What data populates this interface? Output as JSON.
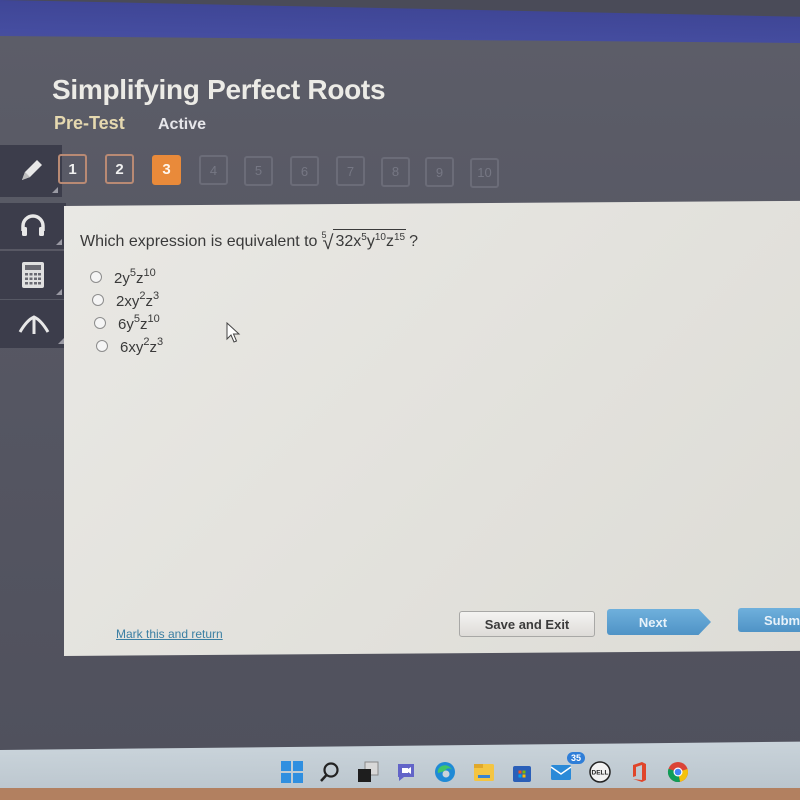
{
  "header": {
    "title": "Simplifying Perfect Roots",
    "subtitle": "Pre-Test",
    "status": "Active"
  },
  "tools": [
    {
      "name": "pencil",
      "icon": "pencil-icon"
    },
    {
      "name": "text-to-speech-headphones",
      "icon": "headphones-icon"
    },
    {
      "name": "calculator",
      "icon": "calculator-icon"
    },
    {
      "name": "collapse-tools",
      "icon": "caret-up-icon"
    }
  ],
  "question_nav": {
    "items": [
      {
        "label": "1",
        "state": "answered"
      },
      {
        "label": "2",
        "state": "answered"
      },
      {
        "label": "3",
        "state": "current"
      },
      {
        "label": "4",
        "state": "locked"
      },
      {
        "label": "5",
        "state": "locked"
      },
      {
        "label": "6",
        "state": "locked"
      },
      {
        "label": "7",
        "state": "locked"
      },
      {
        "label": "8",
        "state": "locked"
      },
      {
        "label": "9",
        "state": "locked"
      },
      {
        "label": "10",
        "state": "locked"
      }
    ],
    "active_color": "#E98A3A"
  },
  "question": {
    "prompt": "Which expression is equivalent to",
    "radical_index": "5",
    "radicand": {
      "coef": "32",
      "terms": [
        {
          "var": "x",
          "exp": "5"
        },
        {
          "var": "y",
          "exp": "10"
        },
        {
          "var": "z",
          "exp": "15"
        }
      ]
    },
    "end_mark": "?"
  },
  "choices": [
    {
      "coef": "2",
      "terms": [
        {
          "var": "y",
          "exp": "5"
        },
        {
          "var": "z",
          "exp": "10"
        }
      ],
      "text": "2y^5z^10",
      "selected": false
    },
    {
      "coef": "2",
      "terms": [
        {
          "var": "x",
          "exp": ""
        },
        {
          "var": "y",
          "exp": "2"
        },
        {
          "var": "z",
          "exp": "3"
        }
      ],
      "text": "2xy^2z^3",
      "selected": false
    },
    {
      "coef": "6",
      "terms": [
        {
          "var": "y",
          "exp": "5"
        },
        {
          "var": "z",
          "exp": "10"
        }
      ],
      "text": "6y^5z^10",
      "selected": false
    },
    {
      "coef": "6",
      "terms": [
        {
          "var": "x",
          "exp": ""
        },
        {
          "var": "y",
          "exp": "2"
        },
        {
          "var": "z",
          "exp": "3"
        }
      ],
      "text": "6xy^2z^3",
      "selected": false
    }
  ],
  "footer": {
    "mark_link": "Mark this and return",
    "save_exit": "Save and Exit",
    "next": "Next",
    "submit": "Submit",
    "button_color": "#5A9FD0"
  },
  "taskbar": {
    "icons": [
      {
        "name": "windows-start-icon"
      },
      {
        "name": "search-icon"
      },
      {
        "name": "task-view-icon"
      },
      {
        "name": "teams-chat-icon"
      },
      {
        "name": "edge-browser-icon"
      },
      {
        "name": "file-explorer-icon"
      },
      {
        "name": "microsoft-store-icon"
      },
      {
        "name": "mail-icon",
        "badge": "35"
      },
      {
        "name": "dell-icon"
      },
      {
        "name": "office-icon"
      },
      {
        "name": "chrome-icon"
      }
    ]
  }
}
